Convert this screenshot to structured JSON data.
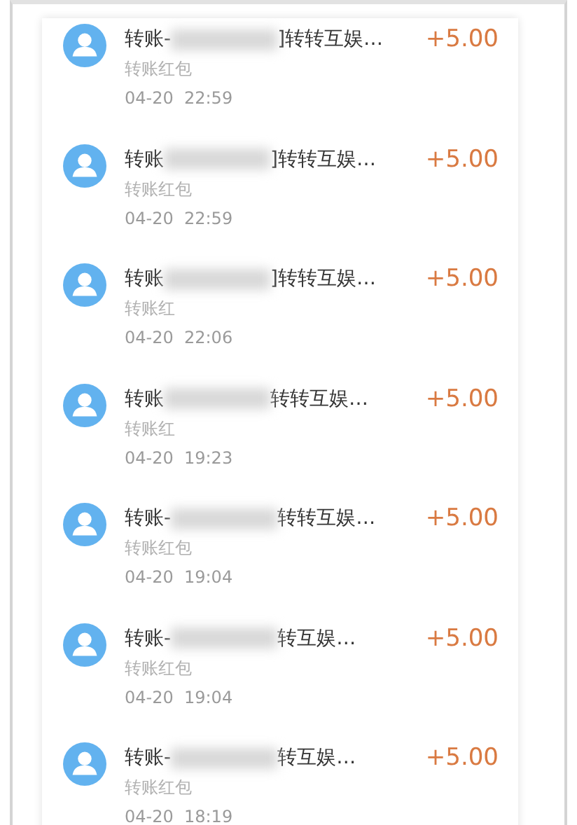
{
  "transactions": [
    {
      "title_start": "转账-",
      "title_end": "]转转互娱…",
      "subtitle": "转账红包",
      "time": "04-20  22:59",
      "amount": "+5.00"
    },
    {
      "title_start": "转账",
      "title_end": "]转转互娱…",
      "subtitle": "转账红包",
      "time": "04-20  22:59",
      "amount": "+5.00"
    },
    {
      "title_start": "转账",
      "title_end": "]转转互娱…",
      "subtitle": "转账红",
      "time": "04-20  22:06",
      "amount": "+5.00"
    },
    {
      "title_start": "转账",
      "title_end": "转转互娱…",
      "subtitle": "转账红",
      "time": "04-20  19:23",
      "amount": "+5.00"
    },
    {
      "title_start": "转账-",
      "title_end": "转转互娱…",
      "subtitle": "转账红包",
      "time": "04-20  19:04",
      "amount": "+5.00"
    },
    {
      "title_start": "转账-",
      "title_end": "转互娱…",
      "subtitle": "转账红包",
      "time": "04-20  19:04",
      "amount": "+5.00"
    },
    {
      "title_start": "转账-",
      "title_end": "转互娱…",
      "subtitle": "转账红包",
      "time": "04-20  18:19",
      "amount": "+5.00"
    }
  ]
}
